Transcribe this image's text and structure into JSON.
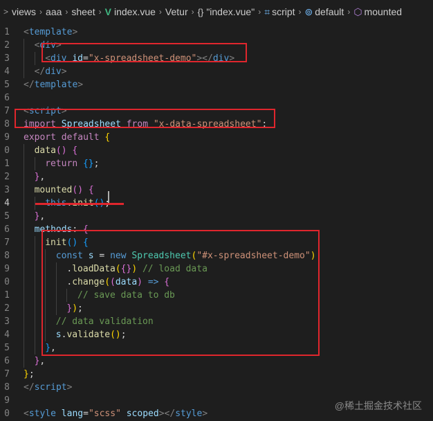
{
  "breadcrumb": {
    "segments": [
      {
        "label": "views",
        "icon": "none"
      },
      {
        "label": "aaa",
        "icon": "none"
      },
      {
        "label": "sheet",
        "icon": "none"
      },
      {
        "label": "index.vue",
        "icon": "vue-logo-icon"
      },
      {
        "label": "Vetur",
        "icon": "none"
      },
      {
        "label": "\"index.vue\"",
        "icon": "braces-icon"
      },
      {
        "label": "script",
        "icon": "script-icon"
      },
      {
        "label": "default",
        "icon": "default-export-icon"
      },
      {
        "label": "mounted",
        "icon": "cube-icon"
      }
    ],
    "leading_chevron": ">"
  },
  "gutter": {
    "line_numbers": [
      "1",
      "2",
      "3",
      "4",
      "5",
      "6",
      "7",
      "8",
      "9",
      "0",
      "1",
      "2",
      "3",
      "4",
      "5",
      "6",
      "7",
      "8",
      "9",
      "0",
      "1",
      "2",
      "3",
      "4",
      "5",
      "6",
      "7",
      "8",
      "9",
      "0"
    ],
    "active_line_index": 13
  },
  "code": {
    "lines": [
      [
        [
          "tk-punct",
          "<"
        ],
        [
          "tk-tag",
          "template"
        ],
        [
          "tk-punct",
          ">"
        ]
      ],
      [
        [
          "tk-punct",
          "<"
        ],
        [
          "tk-tag",
          "div"
        ],
        [
          "tk-punct",
          ">"
        ]
      ],
      [
        [
          "tk-punct",
          "<"
        ],
        [
          "tk-tag",
          "div"
        ],
        [
          "tk-txt",
          " "
        ],
        [
          "tk-attr",
          "id"
        ],
        [
          "tk-txt",
          "="
        ],
        [
          "tk-str",
          "\"x-spreadsheet-demo\""
        ],
        [
          "tk-punct",
          "></"
        ],
        [
          "tk-tag",
          "div"
        ],
        [
          "tk-punct",
          ">"
        ]
      ],
      [
        [
          "tk-punct",
          "</"
        ],
        [
          "tk-tag",
          "div"
        ],
        [
          "tk-punct",
          ">"
        ]
      ],
      [
        [
          "tk-punct",
          "</"
        ],
        [
          "tk-tag",
          "template"
        ],
        [
          "tk-punct",
          ">"
        ]
      ],
      [],
      [
        [
          "tk-punct",
          "<"
        ],
        [
          "tk-tag",
          "script"
        ],
        [
          "tk-punct",
          ">"
        ]
      ],
      [
        [
          "tk-kw",
          "import"
        ],
        [
          "tk-txt",
          " "
        ],
        [
          "tk-var",
          "Spreadsheet"
        ],
        [
          "tk-txt",
          " "
        ],
        [
          "tk-kw",
          "from"
        ],
        [
          "tk-txt",
          " "
        ],
        [
          "tk-str",
          "\"x-data-spreadsheet\""
        ],
        [
          "tk-txt",
          ";"
        ]
      ],
      [
        [
          "tk-kw",
          "export"
        ],
        [
          "tk-txt",
          " "
        ],
        [
          "tk-kw",
          "default"
        ],
        [
          "tk-txt",
          " "
        ],
        [
          "tk-br1",
          "{"
        ]
      ],
      [
        [
          "tk-fn",
          "data"
        ],
        [
          "tk-br2",
          "()"
        ],
        [
          "tk-txt",
          " "
        ],
        [
          "tk-br2",
          "{"
        ]
      ],
      [
        [
          "tk-kw",
          "return"
        ],
        [
          "tk-txt",
          " "
        ],
        [
          "tk-br3",
          "{}"
        ],
        [
          "tk-txt",
          ";"
        ]
      ],
      [
        [
          "tk-br2",
          "}"
        ],
        [
          "tk-txt",
          ","
        ]
      ],
      [
        [
          "tk-fn",
          "mounted"
        ],
        [
          "tk-br2",
          "()"
        ],
        [
          "tk-txt",
          " "
        ],
        [
          "tk-br2",
          "{"
        ]
      ],
      [
        [
          "tk-key",
          "this"
        ],
        [
          "tk-txt",
          "."
        ],
        [
          "tk-fn",
          "init"
        ],
        [
          "tk-br3",
          "()"
        ],
        [
          "tk-txt",
          ";"
        ]
      ],
      [
        [
          "tk-br2",
          "}"
        ],
        [
          "tk-txt",
          ","
        ]
      ],
      [
        [
          "tk-var",
          "methods"
        ],
        [
          "tk-txt",
          ": "
        ],
        [
          "tk-br2",
          "{"
        ]
      ],
      [
        [
          "tk-fn",
          "init"
        ],
        [
          "tk-br3",
          "()"
        ],
        [
          "tk-txt",
          " "
        ],
        [
          "tk-br3",
          "{"
        ]
      ],
      [
        [
          "tk-key",
          "const"
        ],
        [
          "tk-txt",
          " "
        ],
        [
          "tk-var",
          "s"
        ],
        [
          "tk-txt",
          " = "
        ],
        [
          "tk-key",
          "new"
        ],
        [
          "tk-txt",
          " "
        ],
        [
          "tk-cls",
          "Spreadsheet"
        ],
        [
          "tk-br1",
          "("
        ],
        [
          "tk-str",
          "\"#x-spreadsheet-demo\""
        ],
        [
          "tk-br1",
          ")"
        ]
      ],
      [
        [
          "tk-txt",
          "."
        ],
        [
          "tk-fn",
          "loadData"
        ],
        [
          "tk-br1",
          "("
        ],
        [
          "tk-br2",
          "{}"
        ],
        [
          "tk-br1",
          ")"
        ],
        [
          "tk-txt",
          " "
        ],
        [
          "tk-cm",
          "// load data"
        ]
      ],
      [
        [
          "tk-txt",
          "."
        ],
        [
          "tk-fn",
          "change"
        ],
        [
          "tk-br1",
          "("
        ],
        [
          "tk-br2",
          "("
        ],
        [
          "tk-var",
          "data"
        ],
        [
          "tk-br2",
          ")"
        ],
        [
          "tk-txt",
          " "
        ],
        [
          "tk-key",
          "=>"
        ],
        [
          "tk-txt",
          " "
        ],
        [
          "tk-br2",
          "{"
        ]
      ],
      [
        [
          "tk-cm",
          "// save data to db"
        ]
      ],
      [
        [
          "tk-br2",
          "}"
        ],
        [
          "tk-br1",
          ")"
        ],
        [
          "tk-txt",
          ";"
        ]
      ],
      [
        [
          "tk-cm",
          "// data validation"
        ]
      ],
      [
        [
          "tk-var",
          "s"
        ],
        [
          "tk-txt",
          "."
        ],
        [
          "tk-fn",
          "validate"
        ],
        [
          "tk-br1",
          "()"
        ],
        [
          "tk-txt",
          ";"
        ]
      ],
      [
        [
          "tk-br3",
          "}"
        ],
        [
          "tk-txt",
          ","
        ]
      ],
      [
        [
          "tk-br2",
          "}"
        ],
        [
          "tk-txt",
          ","
        ]
      ],
      [
        [
          "tk-br1",
          "}"
        ],
        [
          "tk-txt",
          ";"
        ]
      ],
      [
        [
          "tk-punct",
          "</"
        ],
        [
          "tk-tag",
          "script"
        ],
        [
          "tk-punct",
          ">"
        ]
      ],
      [],
      [
        [
          "tk-punct",
          "<"
        ],
        [
          "tk-tag",
          "style"
        ],
        [
          "tk-txt",
          " "
        ],
        [
          "tk-attr",
          "lang"
        ],
        [
          "tk-txt",
          "="
        ],
        [
          "tk-str",
          "\"scss\""
        ],
        [
          "tk-txt",
          " "
        ],
        [
          "tk-attr",
          "scoped"
        ],
        [
          "tk-punct",
          "></"
        ],
        [
          "tk-tag",
          "style"
        ],
        [
          "tk-punct",
          ">"
        ]
      ]
    ],
    "indent_levels": [
      0,
      1,
      2,
      1,
      0,
      0,
      0,
      0,
      0,
      1,
      2,
      1,
      1,
      2,
      1,
      1,
      2,
      3,
      4,
      4,
      5,
      4,
      3,
      3,
      2,
      1,
      0,
      0,
      0,
      0
    ]
  },
  "annotations": {
    "highlight_color": "#e0262d",
    "note": ""
  },
  "watermark": {
    "text": "@稀土掘金技术社区"
  },
  "colors": {
    "editor_bg": "#1e1e1e",
    "line_number": "#858585",
    "active_line_number": "#c6c6c6"
  }
}
